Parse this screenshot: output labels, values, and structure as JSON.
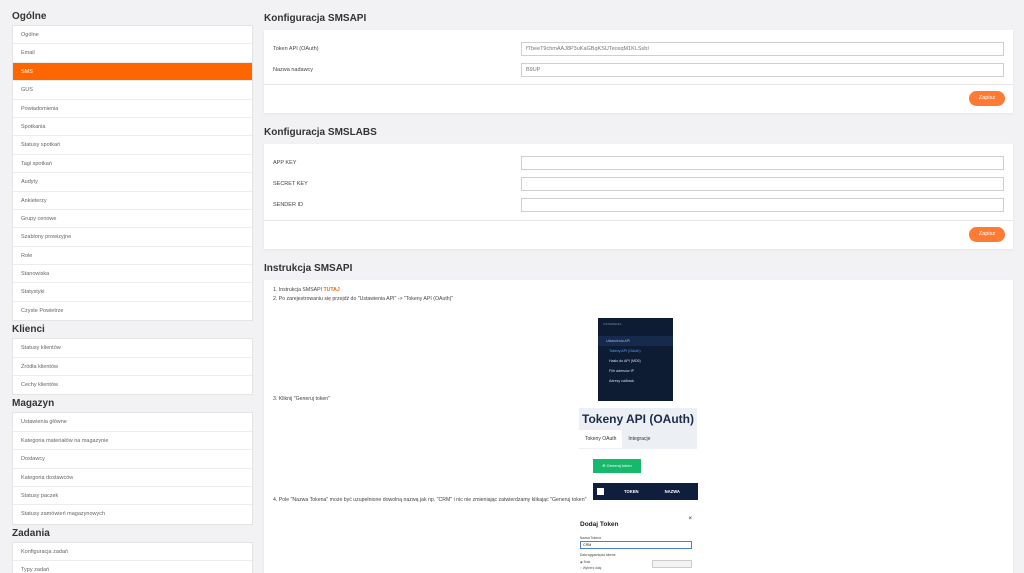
{
  "sidebar": {
    "sections": [
      {
        "title": "Ogólne",
        "items": [
          "Ogólne",
          "Email",
          "SMS",
          "GUS",
          "Powiadomienia",
          "Spotkania",
          "Statusy spotkań",
          "Tagi spotkań",
          "Audyty",
          "Ankieterzy",
          "Grupy cenowe",
          "Szablony prowizyjne",
          "Role",
          "Stanowiska",
          "Statystyki",
          "Czyste Powietrze"
        ],
        "active_index": 2
      },
      {
        "title": "Klienci",
        "items": [
          "Statusy klientów",
          "Źródła klientów",
          "Cechy klientów"
        ]
      },
      {
        "title": "Magazyn",
        "items": [
          "Ustawienia główne",
          "Kategoria materiałów na magazynie",
          "Dostawcy",
          "Kategoria dostawców",
          "Statusy paczek",
          "Statusy zamówień magazynowych"
        ]
      },
      {
        "title": "Zadania",
        "items": [
          "Konfiguracja zadań",
          "Typy zadań"
        ]
      }
    ]
  },
  "smsapi": {
    "title": "Konfiguracja SMSAPI",
    "token_label": "Token API (OAuth)",
    "token_value": "fTbeeT9chmAAJ8P3uKaGBqKSUTeosqM1KLSsbI",
    "sender_label": "Nazwa nadawcy",
    "sender_value": "B9UP",
    "save_label": "Zapisz"
  },
  "smslabs": {
    "title": "Konfiguracja SMSLABS",
    "app_key_label": "APP KEY",
    "secret_key_label": "SECRET KEY",
    "sender_id_label": "SENDER ID",
    "save_label": "Zapisz"
  },
  "instructions": {
    "title": "Instrukcja SMSAPI",
    "step1_text": "1. Instrukcja SMSAPI",
    "step1_link": "TUTAJ",
    "step2": "2. Po zarejestrowaniu się przejdź do \"Ustawienia API\" -> \"Tokeny API (OAuth)\"",
    "step3": "3. Kliknij \"Generuj token\"",
    "step4": "4. Pole \"Nazwa Tokena\" może być uzupełnione dowolną nazwą jak np. \"CRM\" i nic nie zmieniając zatwierdzamy klikając \"Generuj token\"",
    "shot1": {
      "top_label": "USTAWIENIA",
      "header": "Ustawienia API",
      "items": [
        "Tokeny API (OAuth)",
        "Hasło do API (MD5)",
        "Filtr adresów IP",
        "Adresy callback"
      ]
    },
    "shot2": {
      "title": "Tokeny API (OAuth)",
      "tab_active": "Tokeny OAuth",
      "tab_other": "Integracje"
    },
    "generate_button": "Generuj token",
    "shot3": {
      "col1": "TOKEN",
      "col2": "NAZWA"
    },
    "shot4": {
      "title": "Dodaj Token",
      "close": "×",
      "name_label": "Nazwa Tokena",
      "name_value": "CRM",
      "expiry_label": "Data wygaśnięcia tokena",
      "radio1": "Brak",
      "radio2": "Wybierz datę"
    }
  }
}
